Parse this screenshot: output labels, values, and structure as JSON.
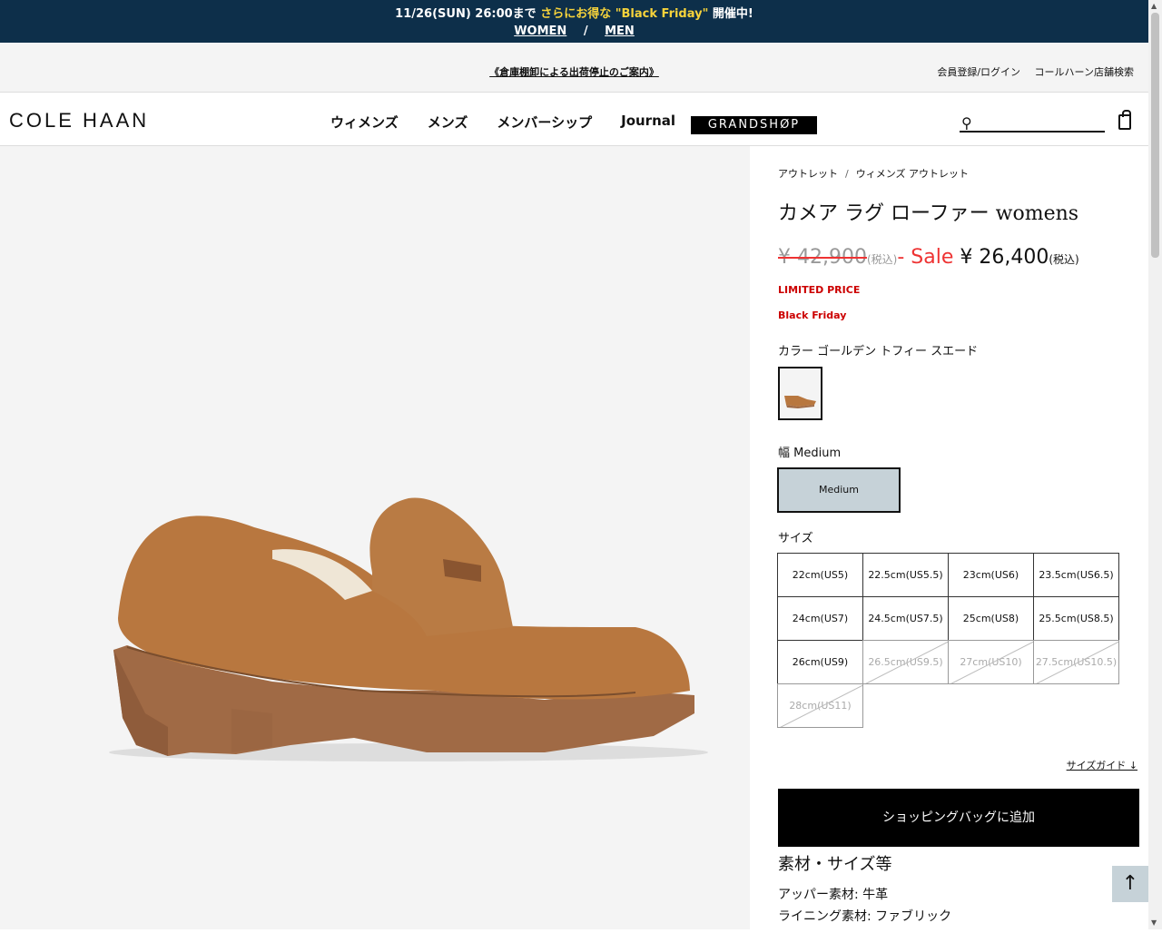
{
  "promo": {
    "prefix": "11/26(SUN) 26:00まで ",
    "highlight": "さらにお得な \"Black Friday\"",
    "suffix": " 開催中!",
    "links": [
      "WOMEN",
      "/",
      "MEN"
    ]
  },
  "notice": {
    "center": "《倉庫棚卸による出荷停止のご案内》",
    "login": "会員登録/ログイン",
    "store": "コールハーン店舗検索"
  },
  "header": {
    "logo": "COLE HAAN",
    "nav": [
      "ウィメンズ",
      "メンズ",
      "メンバーシップ",
      "Journal"
    ],
    "grandshop": "GRANDSHØP",
    "search_placeholder": ""
  },
  "product": {
    "breadcrumb": [
      "アウトレット",
      "/",
      "ウィメンズ アウトレット"
    ],
    "title": "カメア ラグ ローファー womens",
    "original_price": "¥ 42,900",
    "tax_label": "(税込)",
    "dash": "-",
    "sale_label": "Sale",
    "sale_price": "¥ 26,400",
    "limited": "LIMITED PRICE",
    "black_friday": "Black Friday",
    "color_label": "カラー ゴールデン トフィー スエード",
    "width_label": "幅 Medium",
    "width_option": "Medium",
    "size_label": "サイズ",
    "sizes": [
      {
        "label": "22cm(US5)",
        "available": true
      },
      {
        "label": "22.5cm(US5.5)",
        "available": true
      },
      {
        "label": "23cm(US6)",
        "available": true
      },
      {
        "label": "23.5cm(US6.5)",
        "available": true
      },
      {
        "label": "24cm(US7)",
        "available": true
      },
      {
        "label": "24.5cm(US7.5)",
        "available": true
      },
      {
        "label": "25cm(US8)",
        "available": true
      },
      {
        "label": "25.5cm(US8.5)",
        "available": true
      },
      {
        "label": "26cm(US9)",
        "available": true
      },
      {
        "label": "26.5cm(US9.5)",
        "available": false
      },
      {
        "label": "27cm(US10)",
        "available": false
      },
      {
        "label": "27.5cm(US10.5)",
        "available": false
      },
      {
        "label": "28cm(US11)",
        "available": false
      }
    ],
    "size_guide": "サイズガイド ↓",
    "add_to_bag": "ショッピングバッグに追加",
    "materials_title": "素材・サイズ等",
    "upper": "アッパー素材: 牛革",
    "lining": "ライニング素材: ファブリック"
  },
  "to_top": "↑",
  "colors": {
    "brand_navy": "#0d2f4a",
    "sale_red": "#e33333",
    "promo_yellow": "#f6d33b"
  }
}
